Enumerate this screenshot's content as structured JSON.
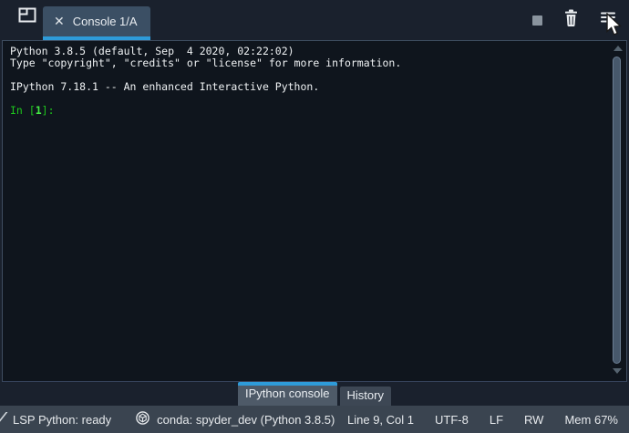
{
  "top_bar": {
    "tab": {
      "label": "Console 1/A",
      "close_glyph": "✕"
    },
    "icons": {
      "browse_tabs": "browse-tabs-icon",
      "stop": "stop-square-icon",
      "trash": "remove-variables-trash-icon",
      "menu": "options-hamburger-icon"
    }
  },
  "console": {
    "banner_lines": [
      "Python 3.8.5 (default, Sep  4 2020, 02:22:02)",
      "Type \"copyright\", \"credits\" or \"license\" for more information.",
      "",
      "IPython 7.18.1 -- An enhanced Interactive Python.",
      ""
    ],
    "prompt": {
      "prefix": "In [",
      "number": "1",
      "suffix": "]:"
    }
  },
  "bottom_tabs": [
    {
      "label": "IPython console",
      "active": true
    },
    {
      "label": "History",
      "active": false
    }
  ],
  "status_bar": {
    "lsp": "LSP Python: ready",
    "conda": "conda: spyder_dev (Python 3.8.5)",
    "cursor_position": "Line 9, Col 1",
    "encoding": "UTF-8",
    "eol": "LF",
    "permissions": "RW",
    "memory": "Mem 67%"
  },
  "colors": {
    "accent_blue": "#2e9bd9",
    "prompt_green": "#1dc51d",
    "prompt_green_bright": "#44ea44",
    "chrome_bg": "#1a212d",
    "console_bg": "#0f151d",
    "status_bg": "#3a4450",
    "tab_bg": "#3b4f64"
  }
}
